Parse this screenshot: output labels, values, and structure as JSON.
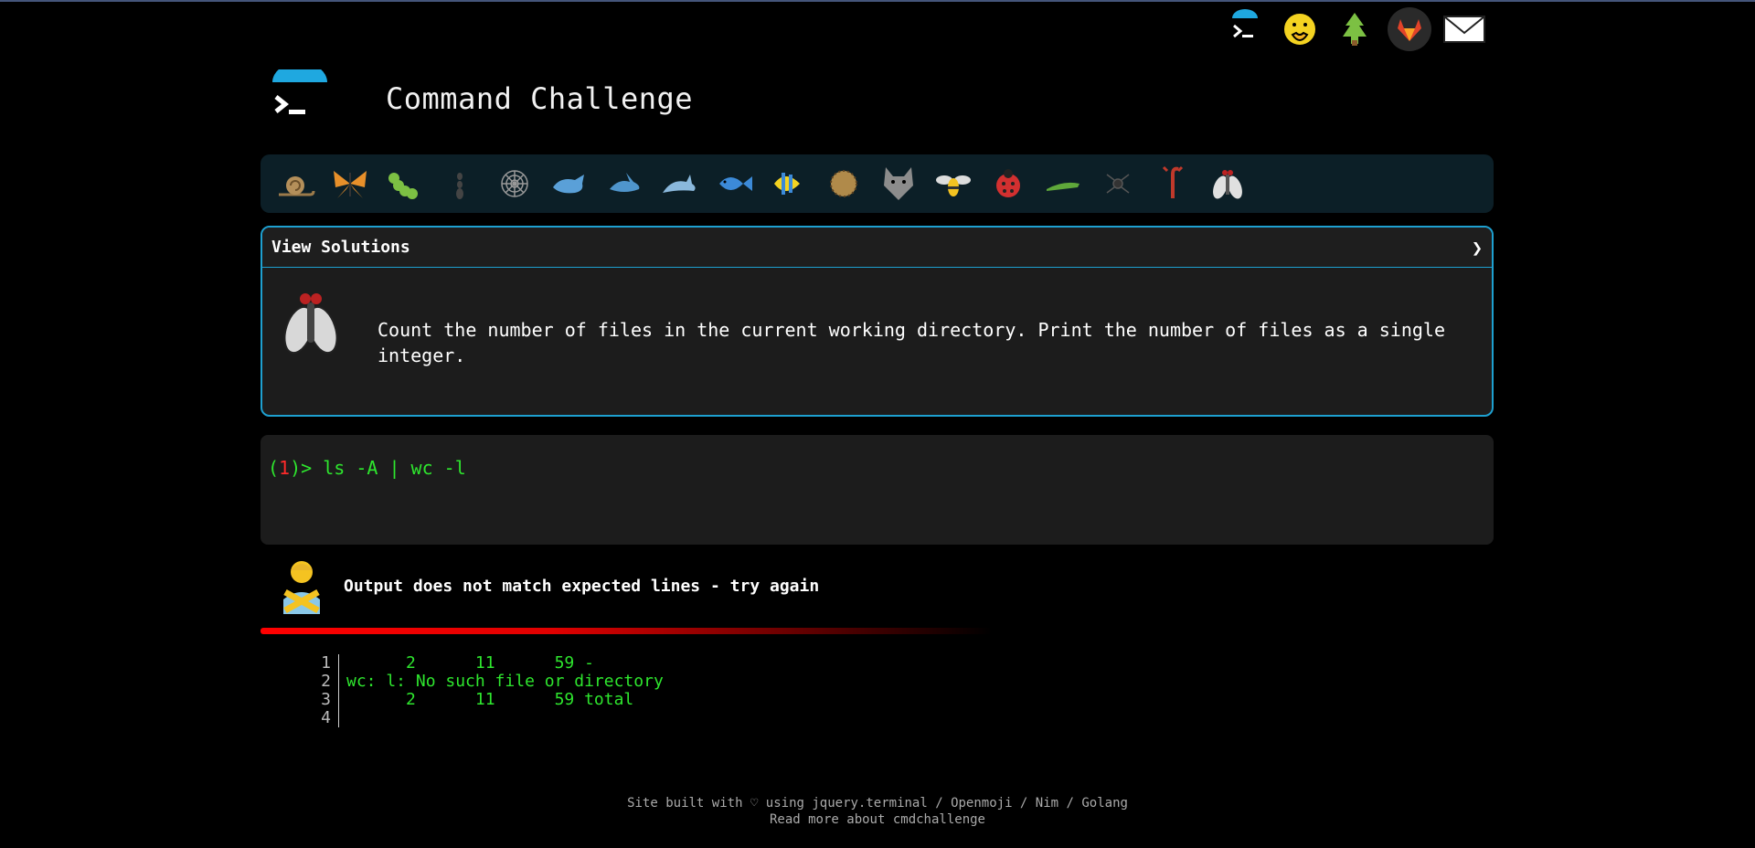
{
  "header": {
    "title": "Command Challenge"
  },
  "top_icons": [
    "terminal-icon",
    "face-hand-over-mouth-icon",
    "pine-tree-icon",
    "gitlab-icon",
    "envelope-icon"
  ],
  "levels": [
    "snail-icon",
    "butterfly-icon",
    "caterpillar-icon",
    "ant-icon",
    "spider-web-icon",
    "whale-icon",
    "shark-icon",
    "dolphin-icon",
    "fish-icon",
    "tropical-fish-icon",
    "blowfish-icon",
    "wolf-icon",
    "bee-icon",
    "ladybug-icon",
    "cricket-icon",
    "spider-icon",
    "scorpion-icon",
    "fly-icon"
  ],
  "solutions": {
    "label": "View Solutions",
    "chevron": "❯",
    "task": "Count the number of files in the current working directory. Print the number of files as a single integer."
  },
  "terminal": {
    "prompt_open": "(",
    "prompt_num": "1",
    "prompt_close": ")> ",
    "command": "ls -A | wc -l"
  },
  "result": {
    "message": "Output does not match expected lines - try again"
  },
  "output": {
    "lines": [
      {
        "n": "1",
        "text": "      2      11      59 -"
      },
      {
        "n": "2",
        "text": "wc: l: No such file or directory"
      },
      {
        "n": "3",
        "text": "      2      11      59 total"
      },
      {
        "n": "4",
        "text": ""
      }
    ]
  },
  "footer": {
    "line1": "Site built with ♡ using jquery.terminal / Openmoji / Nim / Golang",
    "line2": "Read more about cmdchallenge"
  },
  "colors": {
    "accent": "#1ea0d0",
    "prompt_green": "#2ee62e",
    "error_red": "#ff0000"
  }
}
